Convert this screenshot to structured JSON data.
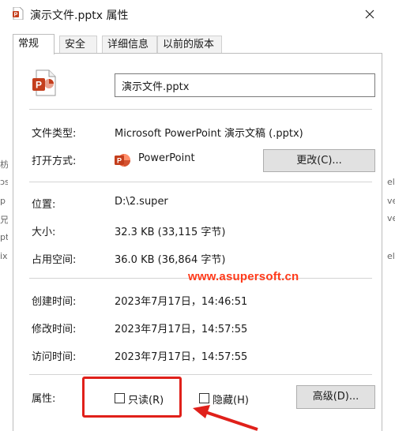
{
  "window": {
    "title": "演示文件.pptx 属性"
  },
  "tabs": [
    {
      "label": "常规",
      "active": true
    },
    {
      "label": "安全",
      "active": false
    },
    {
      "label": "详细信息",
      "active": false
    },
    {
      "label": "以前的版本",
      "active": false
    }
  ],
  "general": {
    "filename": "演示文件.pptx",
    "file_type_label": "文件类型:",
    "file_type_value": "Microsoft PowerPoint 演示文稿 (.pptx)",
    "open_with_label": "打开方式:",
    "open_with_value": "PowerPoint",
    "change_button": "更改(C)...",
    "location_label": "位置:",
    "location_value": "D:\\2.super",
    "size_label": "大小:",
    "size_value": "32.3 KB (33,115 字节)",
    "disk_size_label": "占用空间:",
    "disk_size_value": "36.0 KB (36,864 字节)",
    "created_label": "创建时间:",
    "created_value": "2023年7月17日，14:46:51",
    "modified_label": "修改时间:",
    "modified_value": "2023年7月17日，14:57:55",
    "accessed_label": "访问时间:",
    "accessed_value": "2023年7月17日，14:57:55",
    "attributes_label": "属性:",
    "readonly_label": "只读(R)",
    "hidden_label": "隐藏(H)",
    "advanced_button": "高级(D)..."
  },
  "watermark": "www.asupersoft.cn",
  "background_fragments": {
    "left": [
      "枋",
      "ɔs)",
      "p",
      "兄",
      "ptx",
      "ix"
    ],
    "right": [
      "el",
      "ve",
      "ve",
      "el"
    ]
  },
  "colors": {
    "powerpoint_orange": "#c43e1c",
    "annotation_red": "#e0201a",
    "watermark_red": "#ff3a1a"
  },
  "icons": {
    "title": "powerpoint-file-icon",
    "file": "powerpoint-file-icon",
    "app": "powerpoint-app-icon",
    "close": "close-icon"
  }
}
